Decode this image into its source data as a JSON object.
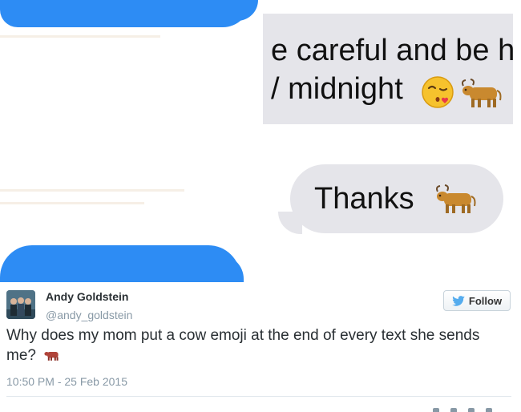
{
  "messages": {
    "gray_line_1": "e careful and be h",
    "gray_line_2": "/ midnight",
    "thanks_text": "Thanks"
  },
  "emoji_icons": [
    "kissing-face-icon",
    "ox-icon"
  ],
  "tweet": {
    "name": "Andy Goldstein",
    "handle": "@andy_goldstein",
    "follow_label": "Follow",
    "text": "Why does my mom put a cow emoji at the end of every text she sends me?",
    "timestamp": "10:50 PM - 25 Feb 2015"
  },
  "colors": {
    "imessage_blue": "#2d8cf4",
    "bubble_gray": "#e5e5ea",
    "twitter_blue": "#55acee"
  }
}
